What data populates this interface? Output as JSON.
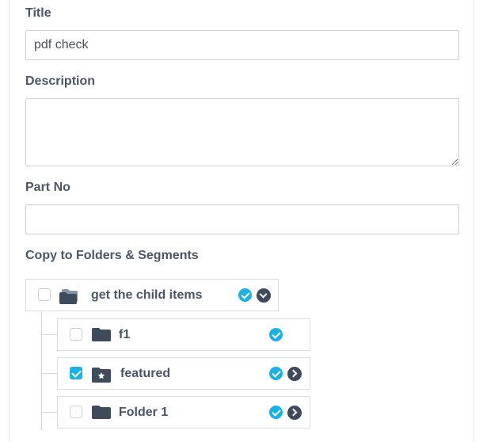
{
  "form": {
    "title_label": "Title",
    "title_value": "pdf check",
    "description_label": "Description",
    "description_value": "",
    "partno_label": "Part No",
    "partno_value": "",
    "copy_label": "Copy to Folders & Segments"
  },
  "tree": {
    "root": {
      "label": "get the child items",
      "checked": false,
      "icon": "folders-icon",
      "expand": "chevron-down-icon"
    },
    "children": [
      {
        "label": "f1",
        "checked": false,
        "icon": "folder-icon"
      },
      {
        "label": "featured",
        "checked": true,
        "icon": "folder-star-icon",
        "expand": "chevron-right-icon"
      },
      {
        "label": "Folder 1",
        "checked": false,
        "icon": "folder-icon",
        "expand": "chevron-right-icon"
      }
    ]
  },
  "colors": {
    "accent": "#1ab0e8",
    "icon_dark": "#3d4b5c",
    "label_text": "#4a5568",
    "border": "#dcdcdc"
  }
}
